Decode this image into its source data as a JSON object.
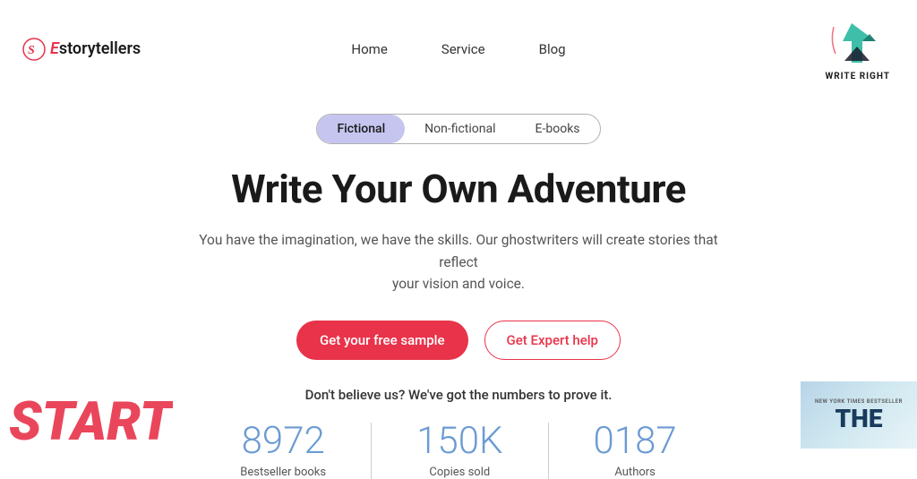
{
  "header": {
    "logo": {
      "prefix": "E",
      "brand": "story",
      "suffix": "tellers"
    },
    "nav": {
      "items": [
        {
          "label": "Home",
          "href": "#"
        },
        {
          "label": "Service",
          "href": "#"
        },
        {
          "label": "Blog",
          "href": "#"
        }
      ]
    },
    "right_logo_label": "Write Right"
  },
  "tabs": {
    "items": [
      {
        "label": "Fictional",
        "active": true
      },
      {
        "label": "Non-fictional",
        "active": false
      },
      {
        "label": "E-books",
        "active": false
      }
    ]
  },
  "hero": {
    "title": "Write Your Own Adventure",
    "subtitle_line1": "You have the imagination, we have the skills. Our ghostwriters will create stories that reflect",
    "subtitle_line2": "your vision and voice.",
    "cta_primary": "Get your free sample",
    "cta_secondary": "Get Expert help"
  },
  "stats": {
    "tagline": "Don't believe us? We've got the numbers to prove it.",
    "items": [
      {
        "number": "8972",
        "label": "Bestseller books"
      },
      {
        "number": "150K",
        "label": "Copies sold"
      },
      {
        "number": "0187",
        "label": "Authors"
      }
    ]
  },
  "bottom": {
    "left_text": "START",
    "right_book_top_text": "NEW YORK TIMES BESTSELLER",
    "right_book_title": "THE"
  }
}
